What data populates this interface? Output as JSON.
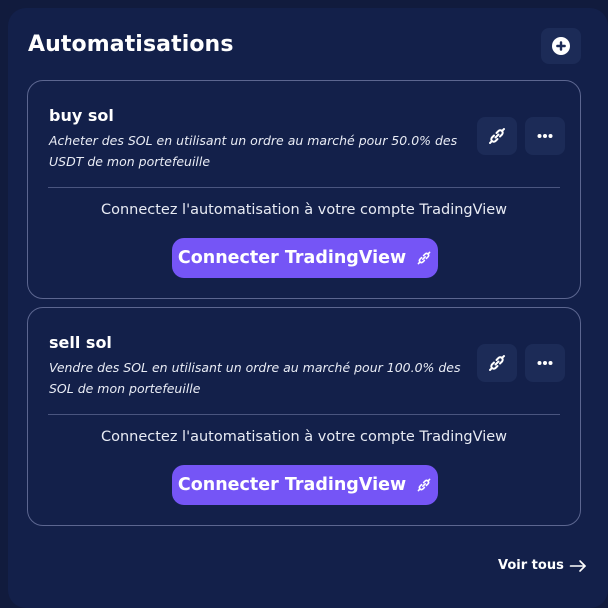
{
  "panel": {
    "title": "Automatisations",
    "add_icon": "plus-circle-icon",
    "view_all_label": "Voir tous",
    "view_all_icon": "arrow-right-icon"
  },
  "automations": [
    {
      "name": "buy sol",
      "description": "Acheter des SOL en utilisant un ordre au marché pour 50.0% des USDT de mon portefeuille",
      "connect_hint": "Connectez l'automatisation à votre compte TradingView",
      "connect_label": "Connecter TradingView",
      "link_icon": "link-icon",
      "more_icon": "more-horizontal-icon"
    },
    {
      "name": "sell sol",
      "description": "Vendre des SOL en utilisant un ordre au marché pour 100.0% des SOL de mon portefeuille",
      "connect_hint": "Connectez l'automatisation à votre compte TradingView",
      "connect_label": "Connecter TradingView",
      "link_icon": "link-icon",
      "more_icon": "more-horizontal-icon"
    }
  ],
  "colors": {
    "background": "#111b3d",
    "panel": "#13204a",
    "card_border": "#5c6690",
    "icon_button": "#1c2b57",
    "accent": "#7555f6"
  }
}
